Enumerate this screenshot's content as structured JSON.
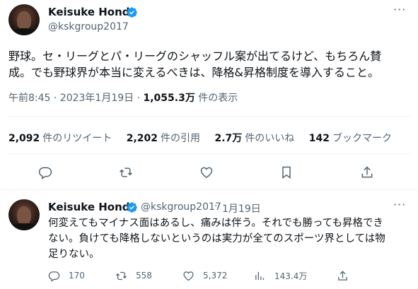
{
  "tweet": {
    "author_name": "Keisuke Honda",
    "author_handle": "@kskgroup2017",
    "text_line1": "野球。セ・リーグとパ・リーグのシャッフル案が出てるけど、もちろん賛",
    "text_line2": "成。でも野球界が本当に変えるべきは、降格&昇格制度を導入すること。",
    "time": "午前8:45 · 2023年1月19日 · ",
    "views_count": "1,055.3万",
    "views_label": " 件の表示",
    "more_label": "···"
  },
  "stats": {
    "retweets_count": "2,092",
    "retweets_label": "件のリツイート",
    "quotes_count": "2,202",
    "quotes_label": "件の引用",
    "likes_count": "2.7万",
    "likes_label": "件のいいね",
    "bookmarks_count": "142",
    "bookmarks_label": "ブックマーク"
  },
  "actions": {
    "icons": [
      "reply-icon",
      "retweet-icon",
      "like-icon",
      "bookmark-icon",
      "share-icon"
    ]
  },
  "reply": {
    "author_name": "Keisuke Honda",
    "author_handle": "@kskgroup2017",
    "dot": "·",
    "date": "1月19日",
    "text_line1": "何変えてもマイナス面はあるし、痛みは伴う。それでも勝っても昇格でき",
    "text_line2": "ない。負けても降格しないというのは実力が全てのスポーツ界としては物",
    "text_line3": "足りない。",
    "replies": "170",
    "retweets": "558",
    "likes": "5,372",
    "views": "143.4万",
    "more_label": "···"
  },
  "colors": {
    "text": "#0f1419",
    "secondary": "#536471",
    "verified": "#1d9bf0",
    "divider": "#eff3f4"
  }
}
